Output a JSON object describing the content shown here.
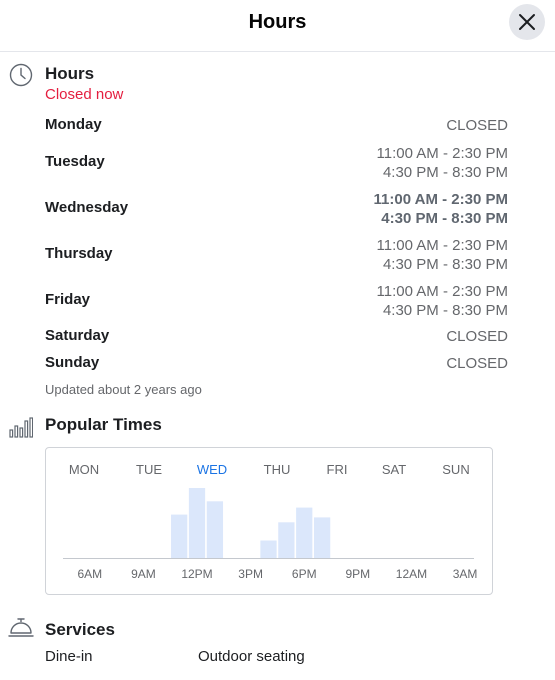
{
  "header": {
    "title": "Hours"
  },
  "hours": {
    "title": "Hours",
    "status": "Closed now",
    "days": [
      {
        "name": "Monday",
        "hours": [
          "CLOSED"
        ],
        "today": false
      },
      {
        "name": "Tuesday",
        "hours": [
          "11:00 AM - 2:30 PM",
          "4:30 PM - 8:30 PM"
        ],
        "today": false
      },
      {
        "name": "Wednesday",
        "hours": [
          "11:00 AM - 2:30 PM",
          "4:30 PM - 8:30 PM"
        ],
        "today": true
      },
      {
        "name": "Thursday",
        "hours": [
          "11:00 AM - 2:30 PM",
          "4:30 PM - 8:30 PM"
        ],
        "today": false
      },
      {
        "name": "Friday",
        "hours": [
          "11:00 AM - 2:30 PM",
          "4:30 PM - 8:30 PM"
        ],
        "today": false
      },
      {
        "name": "Saturday",
        "hours": [
          "CLOSED"
        ],
        "today": false
      },
      {
        "name": "Sunday",
        "hours": [
          "CLOSED"
        ],
        "today": false
      }
    ],
    "updated": "Updated about 2 years ago"
  },
  "popular_times": {
    "title": "Popular Times",
    "day_tabs": [
      "MON",
      "TUE",
      "WED",
      "THU",
      "FRI",
      "SAT",
      "SUN"
    ],
    "selected_day": "WED"
  },
  "chart_data": {
    "type": "bar",
    "title": "",
    "xlabel": "",
    "ylabel": "",
    "x_tick_labels": [
      "6AM",
      "9AM",
      "12PM",
      "3PM",
      "6PM",
      "9PM",
      "12AM",
      "3AM"
    ],
    "x_range_hours": [
      5,
      28
    ],
    "bars": [
      {
        "hour": 11,
        "value": 62
      },
      {
        "hour": 12,
        "value": 100
      },
      {
        "hour": 13,
        "value": 81
      },
      {
        "hour": 16,
        "value": 25
      },
      {
        "hour": 17,
        "value": 51
      },
      {
        "hour": 18,
        "value": 72
      },
      {
        "hour": 19,
        "value": 58
      }
    ],
    "ylim": [
      0,
      100
    ],
    "grid": false,
    "colors": {
      "bar": "#dbe7fb",
      "tab_selected": "#1b74e4",
      "tab": "#65676b",
      "baseline": "#c4c8ce"
    }
  },
  "services": {
    "title": "Services",
    "items": [
      "Dine-in",
      "Outdoor seating"
    ]
  }
}
